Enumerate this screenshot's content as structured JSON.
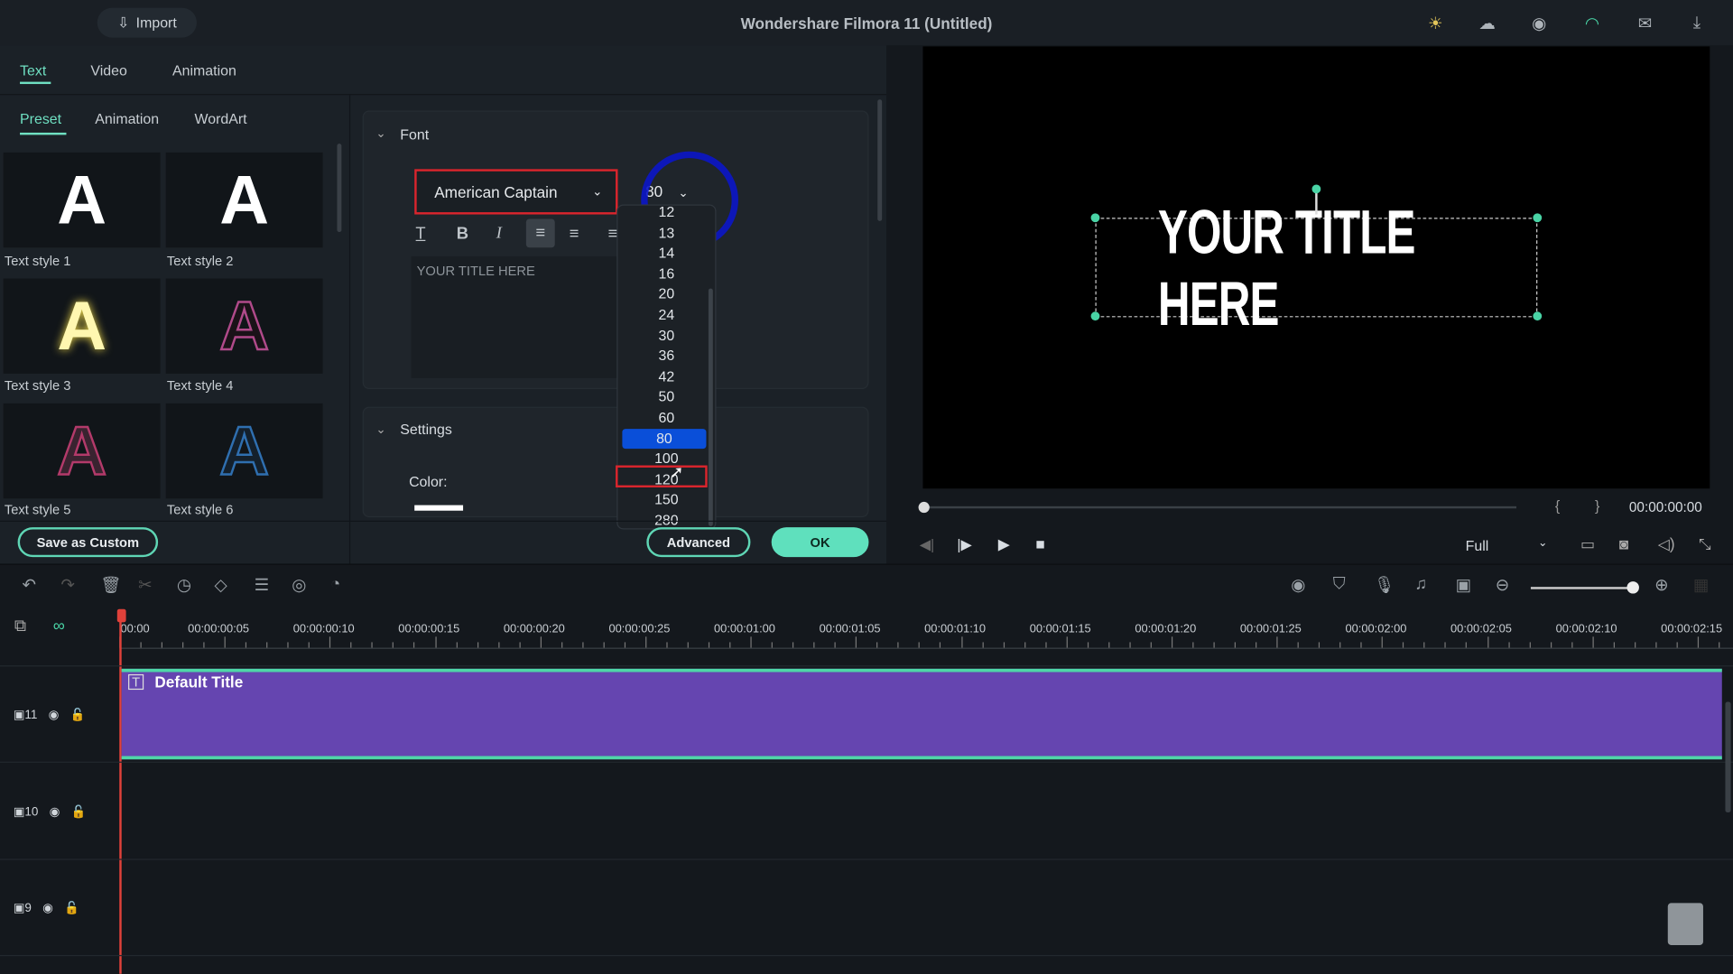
{
  "app": {
    "title": "Wondershare Filmora 11 (Untitled)",
    "import_label": "Import"
  },
  "top_icons": [
    "bulb-icon",
    "cloud-icon",
    "account-icon",
    "headset-icon",
    "mail-icon",
    "download-icon"
  ],
  "panel": {
    "tabs": [
      {
        "label": "Text",
        "active": true
      },
      {
        "label": "Video"
      },
      {
        "label": "Animation"
      }
    ],
    "subtabs": [
      {
        "label": "Preset",
        "active": true
      },
      {
        "label": "Animation"
      },
      {
        "label": "WordArt"
      }
    ],
    "presets": [
      {
        "label": "Text style 1"
      },
      {
        "label": "Text style 2"
      },
      {
        "label": "Text style 3"
      },
      {
        "label": "Text style 4"
      },
      {
        "label": "Text style 5"
      },
      {
        "label": "Text style 6"
      }
    ],
    "font_section": {
      "title": "Font",
      "font": "American Captain",
      "size": "80",
      "text": "YOUR TITLE HERE"
    },
    "size_options": [
      "12",
      "13",
      "14",
      "16",
      "20",
      "24",
      "30",
      "36",
      "42",
      "50",
      "60",
      "80",
      "100",
      "120",
      "150",
      "280"
    ],
    "size_selected": "80",
    "settings_section": {
      "title": "Settings",
      "color_label": "Color:"
    },
    "buttons": {
      "save_custom": "Save as Custom",
      "advanced": "Advanced",
      "ok": "OK"
    }
  },
  "preview": {
    "title_text": "YOUR TITLE HERE",
    "timecode": "00:00:00:00",
    "quality": "Full",
    "progress": 0
  },
  "timeline": {
    "ticks": [
      "00:00",
      "00:00:00:05",
      "00:00:00:10",
      "00:00:00:15",
      "00:00:00:20",
      "00:00:00:25",
      "00:00:01:00",
      "00:00:01:05",
      "00:00:01:10",
      "00:00:01:15",
      "00:00:01:20",
      "00:00:01:25",
      "00:00:02:00",
      "00:00:02:05",
      "00:00:02:10",
      "00:00:02:15"
    ],
    "tracks": [
      {
        "number": "11",
        "clip": "Default Title"
      },
      {
        "number": "10"
      },
      {
        "number": "9"
      }
    ]
  },
  "colors": {
    "accent": "#6fe0c2",
    "clip": "#6545b0",
    "selection": "#0a4fd9"
  }
}
